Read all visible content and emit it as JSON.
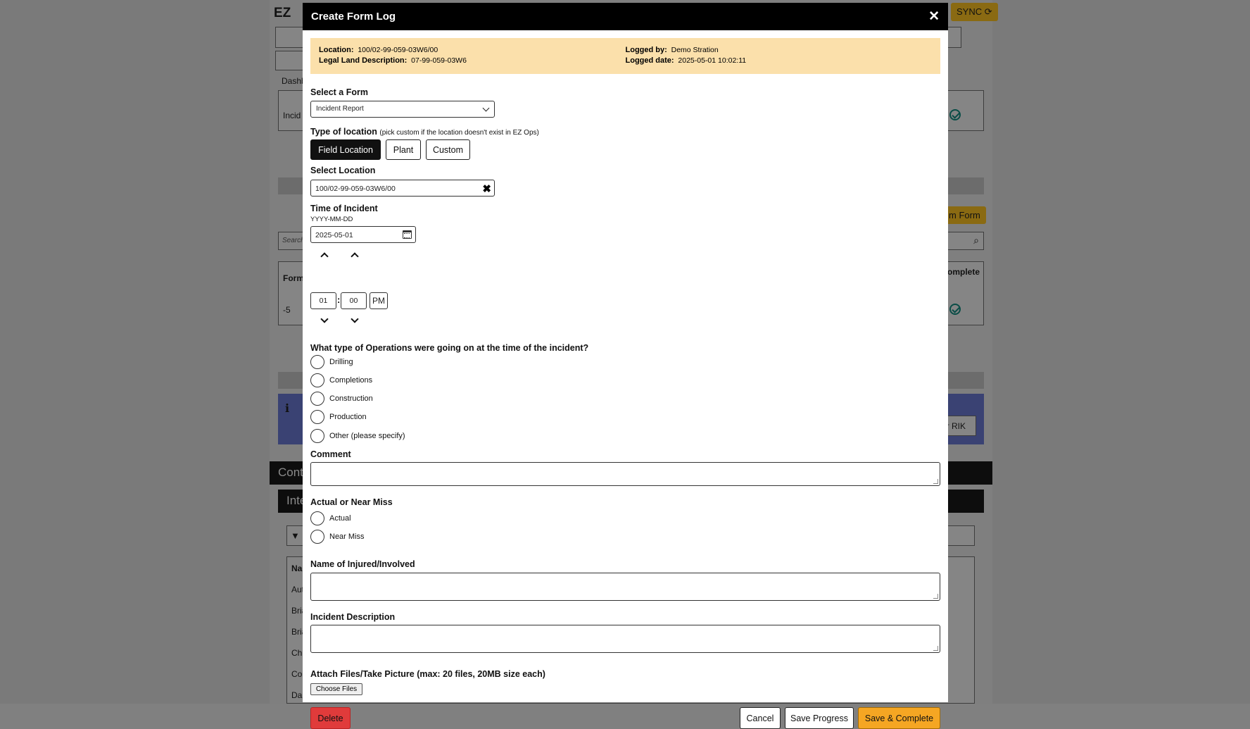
{
  "background": {
    "logo_text": "EZ",
    "sync_label": "SYNC",
    "dashboard_tab": "Dashb",
    "incident_row_label": "Incid",
    "form_column_header": "Form",
    "form_row_value": "-5",
    "search_placeholder": "Search",
    "add_form_button": "m Form",
    "complete_column_header": "omplete",
    "rik_button": "or RIK",
    "contacts_section": "Conta",
    "internal_section": "Inte",
    "names_header": "Nar",
    "name_rows": [
      "Aut",
      "Bria",
      "Bria",
      "Chi",
      "Co",
      "Da"
    ]
  },
  "modal": {
    "title": "Create Form Log",
    "info": {
      "location_label": "Location:",
      "location_value": "100/02-99-059-03W6/00",
      "legal_land_label": "Legal Land Description:",
      "legal_land_value": "07-99-059-03W6",
      "logged_by_label": "Logged by:",
      "logged_by_value": "Demo Stration",
      "logged_date_label": "Logged date:",
      "logged_date_value": "2025-05-01 10:02:11"
    },
    "select_form": {
      "label": "Select a Form",
      "value": "Incident Report"
    },
    "location_type": {
      "label": "Type of location",
      "hint": "(pick custom if the location doesn't exist in EZ Ops)",
      "options": [
        "Field Location",
        "Plant",
        "Custom"
      ],
      "selected": "Field Location"
    },
    "select_location": {
      "label": "Select Location",
      "value": "100/02-99-059-03W6/00"
    },
    "time_of_incident": {
      "label": "Time of Incident",
      "date_format": "YYYY-MM-DD",
      "date_value": "2025-05-01",
      "hour": "01",
      "separator": ":",
      "minute": "00",
      "meridiem": "PM"
    },
    "operations": {
      "question": "What type of Operations were going on at the time of the incident?",
      "options": [
        "Drilling",
        "Completions",
        "Construction",
        "Production",
        "Other (please specify)"
      ]
    },
    "comment": {
      "label": "Comment",
      "value": ""
    },
    "actual_near_miss": {
      "label": "Actual or Near Miss",
      "options": [
        "Actual",
        "Near Miss"
      ]
    },
    "injured": {
      "label": "Name of Injured/Involved",
      "value": ""
    },
    "description": {
      "label": "Incident Description",
      "value": ""
    },
    "attach": {
      "label": "Attach Files/Take Picture (max: 20 files, 20MB size each)",
      "button": "Choose Files"
    },
    "buttons": {
      "delete": "Delete",
      "cancel": "Cancel",
      "save_progress": "Save Progress",
      "save_complete": "Save & Complete"
    }
  },
  "colors": {
    "header_bg": "#000000",
    "info_bg": "#fbe0ab",
    "delete_bg": "#e03b3b",
    "save_complete_bg": "#f5a623",
    "active_toggle_bg": "#111111"
  }
}
